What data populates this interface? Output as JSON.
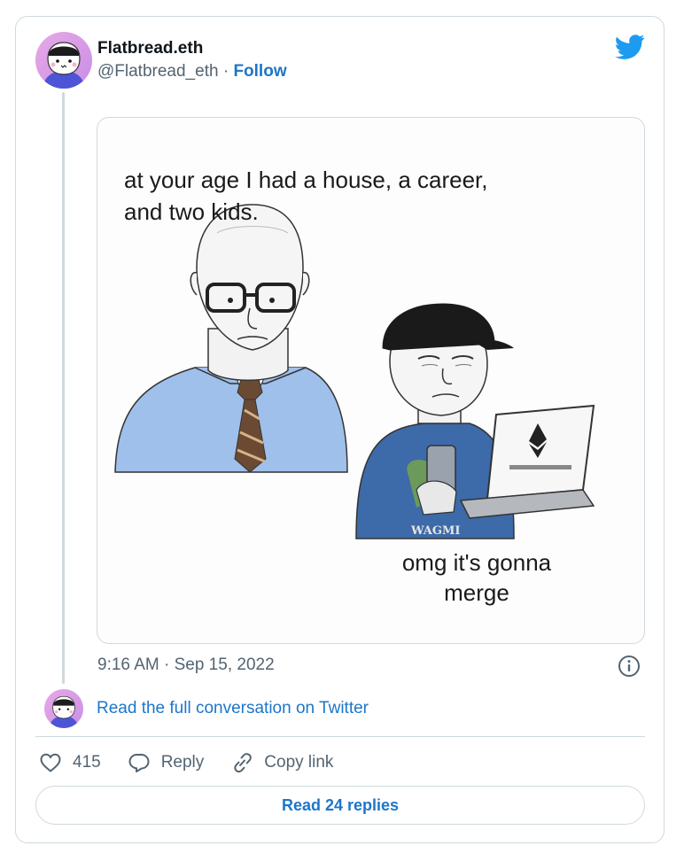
{
  "tweet": {
    "author_name": "Flatbread.eth",
    "author_handle": "@Flatbread_eth",
    "separator": "·",
    "follow_label": "Follow",
    "media": {
      "caption_top": "at your age I had a house, a career, and two kids.",
      "caption_bottom": "omg it's gonna merge",
      "shirt_text": "WAGMI"
    },
    "timestamp": "9:16 AM · Sep 15, 2022",
    "read_conversation_label": "Read the full conversation on Twitter",
    "likes_count": "415",
    "reply_label": "Reply",
    "copy_link_label": "Copy link",
    "read_replies_label": "Read 24 replies"
  },
  "colors": {
    "link_blue": "#1d76c9",
    "twitter_blue": "#1d9bf0",
    "muted_text": "#536471",
    "border": "#cfd9de"
  },
  "icons": [
    "twitter-bird-icon",
    "info-icon",
    "heart-icon",
    "reply-icon",
    "link-icon"
  ]
}
